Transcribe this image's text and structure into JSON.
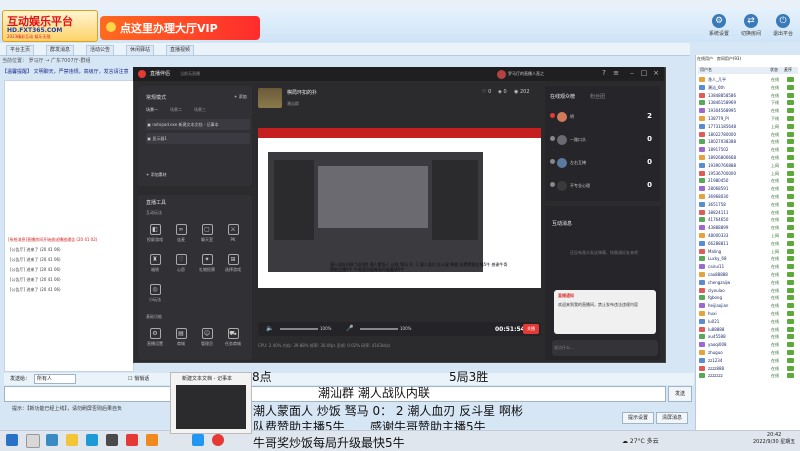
{
  "app": {
    "logo_line1": "互动娱乐平台",
    "logo_line2": "HD.FXT365.COM",
    "logo_line3": "2023精彩互动 娱乐无限",
    "vip_banner": "点这里办理大厅VIP",
    "header_buttons": [
      "系统设置",
      "切换房间",
      "退出平台"
    ],
    "tabs": [
      "平台主页",
      "群发消息",
      "活动公告",
      "休闲驿站",
      "直播视频"
    ],
    "breadcrumb": "当前位置： 罗马厅 → 广东7007厅-群组",
    "notice": "【温馨提醒】 文明聊天，严禁违规，高级厅，发言请注意",
    "chat_red": "[系统消息]直播房间开始放送播放通告 (20 41 02)",
    "chat_lines": [
      "[公告厅] 进来了 (20 41 06)",
      "[公告厅] 进来了 (20 41 06)",
      "[公告厅] 进来了 (20 41 06)",
      "[公告厅] 进来了 (20 41 06)",
      "[公告厅] 进来了 (20 41 06)"
    ],
    "say_label": "发送给：",
    "say_target": "所有人",
    "whisper": "悄悄话",
    "send": "发送",
    "hint": "提示：【新功能已经上线】，请勿刷屏否则后果自负",
    "btn_sound": "提示设置",
    "btn_clear": "清屏消息",
    "user_tabs": [
      "在线用户",
      "房间用户(93)"
    ],
    "user_head": [
      "用户名",
      "状态",
      "麦序"
    ],
    "users": [
      {
        "name": "渔人_几乎",
        "status": "在线"
      },
      {
        "name": "潮汕_6th",
        "status": "在线"
      },
      {
        "name": "13848858586",
        "status": "在线"
      },
      {
        "name": "13846158969",
        "status": "下线"
      },
      {
        "name": "19304568995",
        "status": "在线"
      },
      {
        "name": "138779_Pl",
        "status": "下线"
      },
      {
        "name": "17731185648",
        "status": "上网"
      },
      {
        "name": "18022780000",
        "status": "在线"
      },
      {
        "name": "18027038388",
        "status": "在线"
      },
      {
        "name": "18917502",
        "status": "在线"
      },
      {
        "name": "18926806668",
        "status": "在线"
      },
      {
        "name": "19390766888",
        "status": "上网"
      },
      {
        "name": "19536700000",
        "status": "上网"
      },
      {
        "name": "21980450",
        "status": "在线"
      },
      {
        "name": "28068591",
        "status": "在线"
      },
      {
        "name": "36968030",
        "status": "在线"
      },
      {
        "name": "3651758",
        "status": "在线"
      },
      {
        "name": "38824111",
        "status": "在线"
      },
      {
        "name": "41764650",
        "status": "在线"
      },
      {
        "name": "43888899",
        "status": "在线"
      },
      {
        "name": "48000333",
        "status": "上网"
      },
      {
        "name": "66288811",
        "status": "在线"
      },
      {
        "name": "Maling",
        "status": "上网"
      },
      {
        "name": "Lucky_68",
        "status": "在线"
      },
      {
        "name": "cairui11",
        "status": "在线"
      },
      {
        "name": "cao88888",
        "status": "在线"
      },
      {
        "name": "chengzaijw",
        "status": "在线"
      },
      {
        "name": "clyoulao",
        "status": "在线"
      },
      {
        "name": "fgbong",
        "status": "在线"
      },
      {
        "name": "heijiaojian",
        "status": "在线"
      },
      {
        "name": "huxi",
        "status": "在线"
      },
      {
        "name": "lu021",
        "status": "在线"
      },
      {
        "name": "lu88888",
        "status": "在线"
      },
      {
        "name": "xu45588",
        "status": "在线"
      },
      {
        "name": "yaoqi008",
        "status": "在线"
      },
      {
        "name": "zhuguo",
        "status": "在线"
      },
      {
        "name": "zz1234",
        "status": "在线"
      },
      {
        "name": "zzzz888",
        "status": "在线"
      },
      {
        "name": "zzzzzzz",
        "status": "在线"
      }
    ]
  },
  "live": {
    "app_name": "直播伴侣",
    "app_hint": "当前无直播",
    "user": "罗马厅的直播人直之",
    "scene_mode": "常规模式",
    "add_scene": "添加",
    "scene_tabs": [
      "场景一",
      "场景二",
      "场景三"
    ],
    "sources": [
      "notepad.exe 新建文本文档 - 记事本",
      "显示器1"
    ],
    "add_source": "添加素材",
    "tools_title": "直播工具",
    "tools_sub": "互动玩法",
    "tools_row1": [
      "投屏游戏",
      "连麦",
      "聊天室",
      "PK"
    ],
    "tools_row2": [
      "福袋",
      "心愿",
      "礼物投票",
      "选择游戏"
    ],
    "tools_row3": [
      "小玩法"
    ],
    "tools_sub2": "基础功能",
    "tools_row4": [
      "直播设置",
      "商城",
      "管理员",
      "任务商城"
    ],
    "stream_title": "棋局环扣的扑",
    "stream_sub": "潮汕群",
    "likes": "0",
    "gifts": "0",
    "viewers": "202",
    "timer": "00:51:54",
    "live_btn": "关播",
    "status": "CPU: 2.40%  内存: 39.88%  帧率: 30.0fps  丢帧: 0.02%  码率: 4163kb/s",
    "online_title": "在线观众榜",
    "online_sub": "粉丝团",
    "online": [
      {
        "name": "明",
        "score": "2"
      },
      {
        "name": "一路口头",
        "score": "0"
      },
      {
        "name": "左右互搏",
        "score": "0"
      },
      {
        "name": "不专业心理",
        "score": "0"
      }
    ],
    "interact_title": "互动消息",
    "interact_empty": "还没有观众发送弹幕，快邀请好友来吧",
    "msg_card_title": "直播通知",
    "msg_card_text": "欢迎来到我的直播间，禁止发布违法违规内容",
    "msg_input": "说点什么..."
  },
  "overlay": {
    "line1_left": "8点",
    "line1_right": "5局3胜",
    "line2": "潮汕群  潮人战队内联",
    "line3": "潮人蒙面人 炒饭 驽马  0：  2  潮人血刃 反斗星  啊彬",
    "line4_left": "队费赞助主播5牛",
    "line4_right": "感谢牛哥赞助主播5牛",
    "line5": "牛哥奖炒饭每局升级最快5牛",
    "small": "潮人战队内联 5局3胜 潮人蒙面人 炒饭 驽马 0：2 潮人血刃 反斗星 啊彬 队费赞助主播5牛 感谢牛哥赞助主播5牛 牛哥奖炒饭每局升级最快5牛"
  },
  "taskbar": {
    "thumb_title": "新建文本文档 - 记事本",
    "weather": "27°C 多云",
    "time": "20:42",
    "date": "2022/9/30 星期五"
  }
}
